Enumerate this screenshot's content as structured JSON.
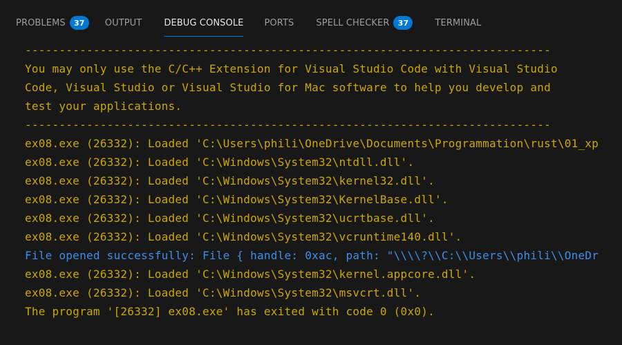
{
  "tabs": [
    {
      "label": "PROBLEMS",
      "badge": "37",
      "active": false
    },
    {
      "label": "OUTPUT",
      "badge": null,
      "active": false
    },
    {
      "label": "DEBUG CONSOLE",
      "badge": null,
      "active": true
    },
    {
      "label": "PORTS",
      "badge": null,
      "active": false
    },
    {
      "label": "SPELL CHECKER",
      "badge": "37",
      "active": false
    },
    {
      "label": "TERMINAL",
      "badge": null,
      "active": false
    }
  ],
  "colors": {
    "background": "#181818",
    "warning_text": "#cca700",
    "info_text": "#3b8eea",
    "badge": "#0078d4",
    "active_tab_underline": "#0078d4"
  },
  "console": {
    "lines": [
      {
        "text": "-----------------------------------------------------------------------------",
        "kind": "warning"
      },
      {
        "text": "You may only use the C/C++ Extension for Visual Studio Code with Visual Studio",
        "kind": "warning"
      },
      {
        "text": "Code, Visual Studio or Visual Studio for Mac software to help you develop and",
        "kind": "warning"
      },
      {
        "text": "test your applications.",
        "kind": "warning"
      },
      {
        "text": "-----------------------------------------------------------------------------",
        "kind": "warning"
      },
      {
        "text": "ex08.exe (26332): Loaded 'C:\\Users\\phili\\OneDrive\\Documents\\Programmation\\rust\\01_xp",
        "kind": "warning"
      },
      {
        "text": "ex08.exe (26332): Loaded 'C:\\Windows\\System32\\ntdll.dll'.",
        "kind": "warning"
      },
      {
        "text": "ex08.exe (26332): Loaded 'C:\\Windows\\System32\\kernel32.dll'.",
        "kind": "warning"
      },
      {
        "text": "ex08.exe (26332): Loaded 'C:\\Windows\\System32\\KernelBase.dll'.",
        "kind": "warning"
      },
      {
        "text": "ex08.exe (26332): Loaded 'C:\\Windows\\System32\\ucrtbase.dll'.",
        "kind": "warning"
      },
      {
        "text": "ex08.exe (26332): Loaded 'C:\\Windows\\System32\\vcruntime140.dll'.",
        "kind": "warning"
      },
      {
        "text": "File opened successfully: File { handle: 0xac, path: \"\\\\\\\\?\\\\C:\\\\Users\\\\phili\\\\OneDr",
        "kind": "info"
      },
      {
        "text": "ex08.exe (26332): Loaded 'C:\\Windows\\System32\\kernel.appcore.dll'.",
        "kind": "warning"
      },
      {
        "text": "ex08.exe (26332): Loaded 'C:\\Windows\\System32\\msvcrt.dll'.",
        "kind": "warning"
      },
      {
        "text": "The program '[26332] ex08.exe' has exited with code 0 (0x0).",
        "kind": "warning"
      }
    ]
  }
}
